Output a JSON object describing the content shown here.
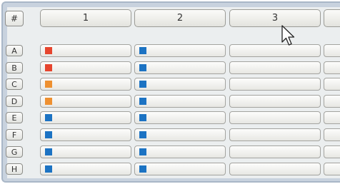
{
  "grid": {
    "corner_label": "#",
    "columns": [
      "1",
      "2",
      "3"
    ],
    "rows": [
      {
        "label": "A",
        "c1": "red",
        "c2": "blue"
      },
      {
        "label": "B",
        "c1": "red",
        "c2": "blue"
      },
      {
        "label": "C",
        "c1": "orange",
        "c2": "blue"
      },
      {
        "label": "D",
        "c1": "orange",
        "c2": "blue"
      },
      {
        "label": "E",
        "c1": "blue",
        "c2": "blue"
      },
      {
        "label": "F",
        "c1": "blue",
        "c2": "blue"
      },
      {
        "label": "G",
        "c1": "blue",
        "c2": "blue"
      },
      {
        "label": "H",
        "c1": "blue",
        "c2": "blue"
      }
    ]
  },
  "colors": {
    "red": "#e6452e",
    "orange": "#ee9030",
    "blue": "#1c73c3"
  },
  "cursor": {
    "icon": "arrow-cursor-icon"
  }
}
